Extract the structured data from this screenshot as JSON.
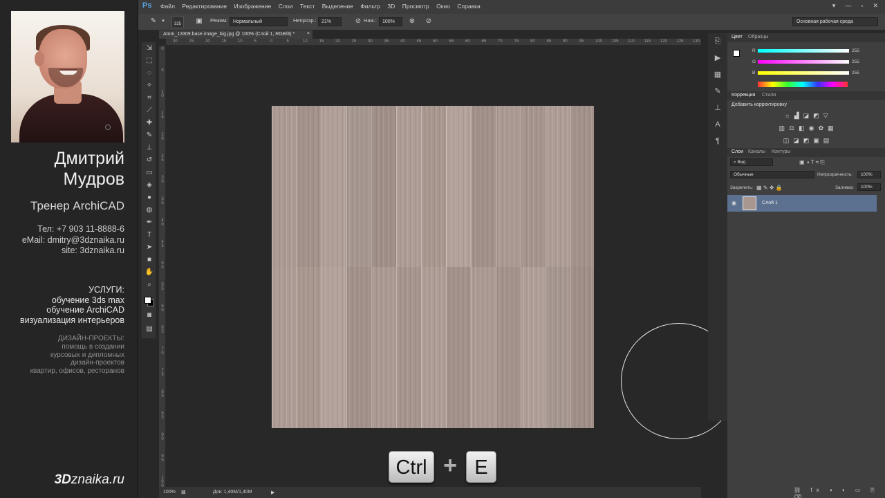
{
  "presenter": {
    "name_line1": "Дмитрий",
    "name_line2": "Мудров",
    "role": "Тренер ArchiCAD",
    "phone": "Тел: +7 903 11-8888-6",
    "email": "eMail: dmitry@3dznaika.ru",
    "site": "site: 3dznaika.ru",
    "services_title": "УСЛУГИ:",
    "services": [
      "обучение 3ds max",
      "обучение ArchiCAD",
      "визуализация интерьеров"
    ],
    "design_title": "ДИЗАЙН-ПРОЕКТЫ:",
    "design": [
      "помощь в создании",
      "курсовых и дипломных",
      "дизайн-проектов",
      "квартир, офисов, ресторанов"
    ],
    "logo_prefix": "3D",
    "logo_suffix": "znaika.ru"
  },
  "app": {
    "logo": "Ps",
    "menu": [
      "Файл",
      "Редактирование",
      "Изображение",
      "Слои",
      "Текст",
      "Выделение",
      "Фильтр",
      "3D",
      "Просмотр",
      "Окно",
      "Справка"
    ],
    "window_controls": [
      "▾",
      "—",
      "▫",
      "✕"
    ]
  },
  "options": {
    "brush_size": "325",
    "mode_label": "Режим:",
    "mode_value": "Нормальный",
    "opacity_label": "Непрозр.:",
    "opacity_value": "21%",
    "pressure_label": "Наж.:",
    "pressure_value": "100%",
    "workspace": "Основная рабочая среда"
  },
  "document": {
    "tab_title": "Atom_13309.base.image_big.jpg @ 100% (Слой 1, RGB/8) *",
    "tab_close": "×",
    "ruler_h": [
      "30",
      "25",
      "20",
      "15",
      "10",
      "5",
      "0",
      "5",
      "10",
      "15",
      "20",
      "25",
      "30",
      "35",
      "40",
      "45",
      "50",
      "55",
      "60",
      "65",
      "70",
      "75",
      "80",
      "85",
      "90",
      "95",
      "100",
      "105",
      "110",
      "115",
      "120",
      "125",
      "130"
    ],
    "ruler_v": [
      "0",
      "5",
      "1\n0",
      "1\n5",
      "2\n0",
      "2\n5",
      "3\n0",
      "3\n5",
      "4\n0",
      "4\n5",
      "5\n0",
      "5\n5",
      "6\n0",
      "6\n5",
      "7\n0",
      "7\n5",
      "8\n0",
      "8\n5",
      "9\n0",
      "9\n5",
      "1\n0\n0"
    ],
    "status_zoom": "100%",
    "status_doc": "Док: 1,40M/1,40M",
    "status_arrow": "▶"
  },
  "keys": {
    "ctrl": "Ctrl",
    "plus": "+",
    "e": "E"
  },
  "panels": {
    "color_tabs": [
      "Цвет",
      "Образцы"
    ],
    "channels": [
      {
        "label": "R",
        "value": "255",
        "color": "#ff3b3b"
      },
      {
        "label": "G",
        "value": "255",
        "color": "#39ff39"
      },
      {
        "label": "B",
        "value": "255",
        "color": "#3b3bff"
      }
    ],
    "adjust_tabs": [
      "Коррекция",
      "Стили"
    ],
    "adjust_title": "Добавить корректировку",
    "layer_tabs": [
      "Слои",
      "Каналы",
      "Контуры"
    ],
    "kind_filter": "Вид",
    "blend_mode": "Обычные",
    "opacity_label": "Непрозрачность:",
    "opacity_value": "100%",
    "lock_label": "Закрепить:",
    "fill_label": "Заливка:",
    "fill_value": "100%",
    "layer_name": "Слой 1"
  }
}
